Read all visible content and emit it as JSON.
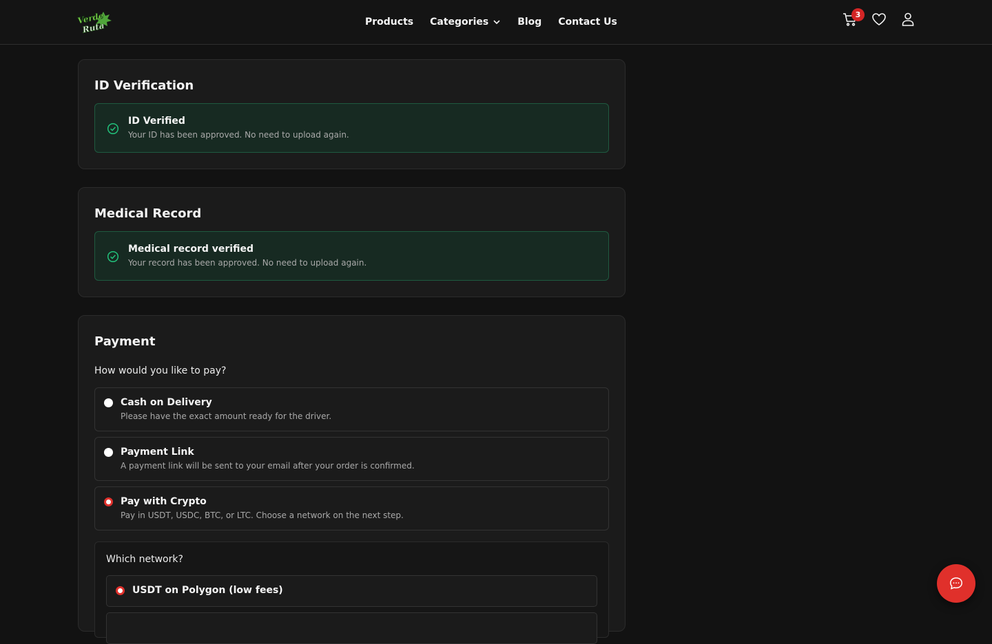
{
  "header": {
    "logo_text": "Verde Ruta",
    "nav": [
      "Products",
      "Categories",
      "Blog",
      "Contact Us"
    ],
    "cart_count": "3"
  },
  "id_card": {
    "title": "ID Verification",
    "status_title": "ID Verified",
    "status_text": "Your ID has been approved. No need to upload again."
  },
  "medical_card": {
    "title": "Medical Record",
    "status_title": "Medical record verified",
    "status_text": "Your record has been approved. No need to upload again."
  },
  "payment": {
    "title": "Payment",
    "question": "How would you like to pay?",
    "options": [
      {
        "label": "Cash on Delivery",
        "desc": "Please have the exact amount ready for the driver.",
        "selected": false
      },
      {
        "label": "Payment Link",
        "desc": "A payment link will be sent to your email after your order is confirmed.",
        "selected": false
      },
      {
        "label": "Pay with Crypto",
        "desc": "Pay in USDT, USDC, BTC, or LTC. Choose a network on the next step.",
        "selected": true
      }
    ],
    "network_question": "Which network?",
    "networks": [
      {
        "label": "USDT on Polygon (low fees)",
        "selected": true
      }
    ]
  },
  "colors": {
    "accent": "#e0302b",
    "success_border": "#1f5a40",
    "success_bg": "#172a22",
    "success_icon": "#22c07a"
  },
  "icons": {
    "cart": "cart-icon",
    "wishlist": "heart-icon",
    "account": "user-icon",
    "chat": "chat-icon",
    "verified": "check-circle-icon"
  }
}
